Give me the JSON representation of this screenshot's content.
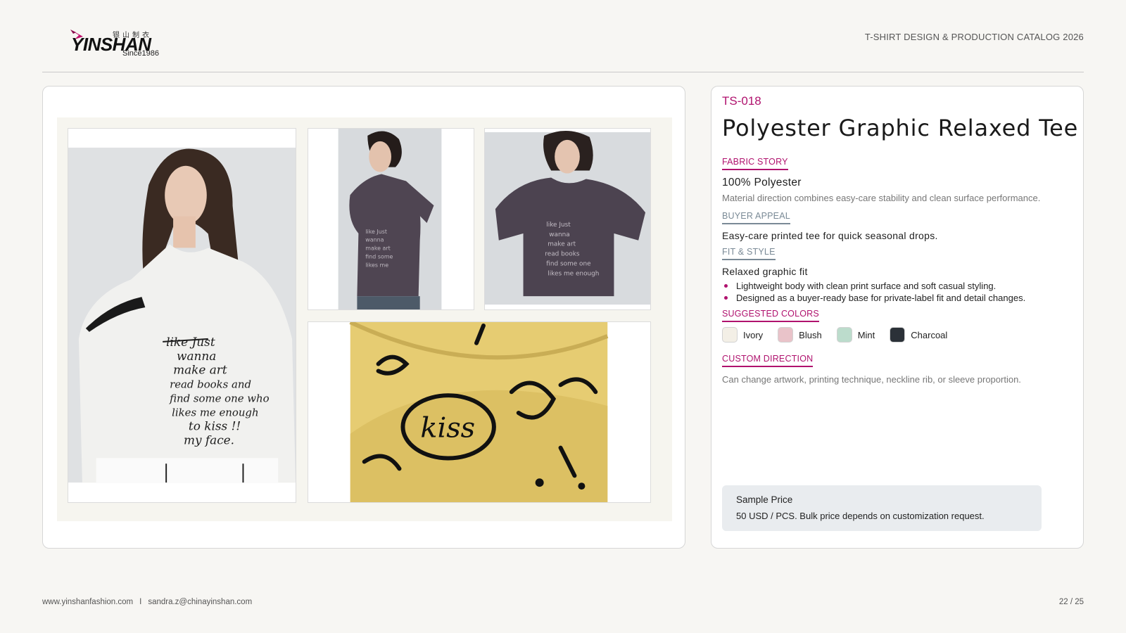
{
  "header": {
    "logo": {
      "wordmark": "YINSHAN",
      "chinese": "银山制衣",
      "since": "Since1986"
    },
    "catalog_title": "T-SHIRT DESIGN & PRODUCTION CATALOG 2026"
  },
  "gallery": {
    "images": [
      {
        "name": "front-view-photo",
        "description_icon": "model-ivory-tee"
      },
      {
        "name": "side-view-photo",
        "description_icon": "model-charcoal-tee-side"
      },
      {
        "name": "front-charcoal-photo",
        "description_icon": "model-charcoal-tee-front"
      },
      {
        "name": "print-detail-photo",
        "description_icon": "fabric-print-closeup"
      }
    ],
    "print_text": [
      "like Just",
      "wanna",
      "make art",
      "read books and",
      "find some one who",
      "likes me enough",
      "to kiss !!",
      "my face."
    ]
  },
  "product": {
    "code": "TS-018",
    "title": "Polyester Graphic Relaxed Tee",
    "fabric_label": "FABRIC STORY",
    "fabric_main": "100% Polyester",
    "fabric_desc": "Material direction combines easy-care stability and clean surface performance.",
    "buyer_label": "BUYER APPEAL",
    "buyer_main": "Easy-care printed tee for quick seasonal drops.",
    "fit_label": "FIT & STYLE",
    "fit_main": "Relaxed graphic fit",
    "fit_bullets": [
      "Lightweight body with clean print surface and soft casual styling.",
      "Designed as a buyer-ready base for private-label fit and detail changes."
    ],
    "colors_label": "SUGGESTED COLORS",
    "colors": [
      {
        "name": "Ivory",
        "hex": "#f3efe6"
      },
      {
        "name": "Blush",
        "hex": "#e9c3c9"
      },
      {
        "name": "Mint",
        "hex": "#bcdccc"
      },
      {
        "name": "Charcoal",
        "hex": "#2b3138"
      }
    ],
    "custom_label": "CUSTOM DIRECTION",
    "custom_desc": "Can change artwork, printing technique, neckline rib, or sleeve proportion.",
    "price_title": "Sample Price",
    "price_text": "50 USD / PCS. Bulk price depends on customization request."
  },
  "footer": {
    "website": "www.yinshanfashion.com",
    "separator": "I",
    "email": "sandra.z@chinayinshan.com",
    "page": "22 / 25"
  },
  "colors": {
    "accent": "#b0126e",
    "muted_label": "#7a8a96",
    "price_bg": "#e9ecef"
  }
}
